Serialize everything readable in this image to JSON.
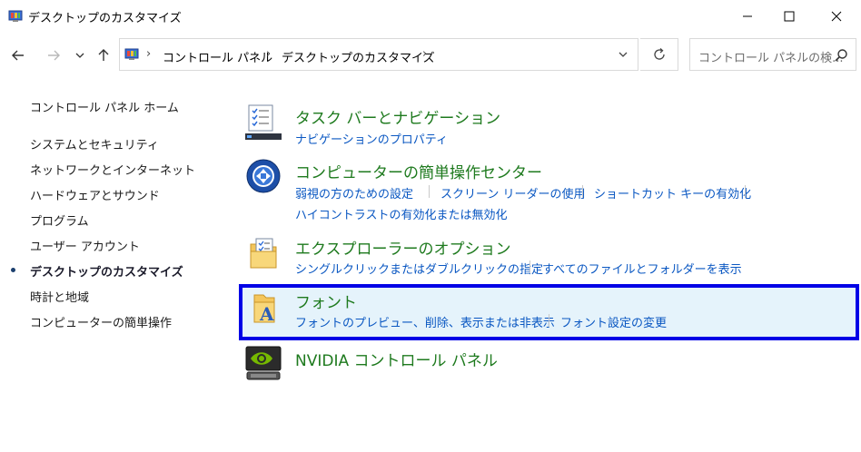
{
  "window": {
    "title": "デスクトップのカスタマイズ"
  },
  "address": {
    "crumbs": [
      "コントロール パネル",
      "デスクトップのカスタマイズ"
    ]
  },
  "search": {
    "placeholder": "コントロール パネルの検..."
  },
  "sidebar": {
    "home": "コントロール パネル ホーム",
    "items": [
      {
        "label": "システムとセキュリティ"
      },
      {
        "label": "ネットワークとインターネット"
      },
      {
        "label": "ハードウェアとサウンド"
      },
      {
        "label": "プログラム"
      },
      {
        "label": "ユーザー アカウント"
      },
      {
        "label": "デスクトップのカスタマイズ",
        "active": true
      },
      {
        "label": "時計と地域"
      },
      {
        "label": "コンピューターの簡単操作"
      }
    ]
  },
  "categories": [
    {
      "title": "タスク バーとナビゲーション",
      "icon": "taskbar-icon",
      "links": [
        "ナビゲーションのプロパティ"
      ]
    },
    {
      "title": "コンピューターの簡単操作センター",
      "icon": "ease-of-access-icon",
      "links": [
        "弱視の方のための設定",
        "スクリーン リーダーの使用",
        "ショートカット キーの有効化",
        "ハイコントラストの有効化または無効化"
      ]
    },
    {
      "title": "エクスプローラーのオプション",
      "icon": "folder-options-icon",
      "links": [
        "シングルクリックまたはダブルクリックの指定",
        "すべてのファイルとフォルダーを表示"
      ]
    },
    {
      "title": "フォント",
      "icon": "fonts-folder-icon",
      "links": [
        "フォントのプレビュー、削除、表示または非表示",
        "フォント設定の変更"
      ]
    },
    {
      "title": "NVIDIA コントロール パネル",
      "icon": "nvidia-icon",
      "links": []
    }
  ],
  "colors": {
    "category_title": "#1e7a1e",
    "link": "#0a57c2",
    "highlight_border": "#0000e6",
    "highlight_bg": "#e5f3fb"
  }
}
